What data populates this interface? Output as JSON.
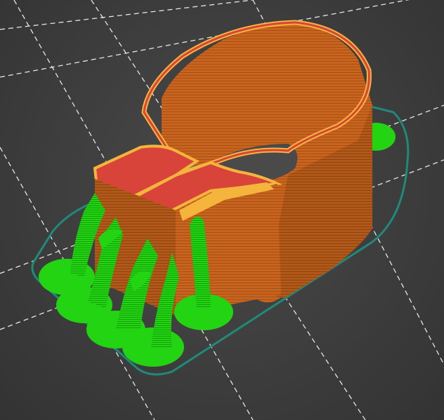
{
  "viewport": {
    "name": "gcode-preview",
    "background_color": "#3c3c3c",
    "bed_line_color": "#e6e6e6",
    "skirt_color": "#1f8a78",
    "wall_color": "#c8641e",
    "wall_dark_color": "#9c4a14",
    "perimeter_color": "#f5b53c",
    "top_infill_color": "#d8443a",
    "support_color": "#22d411",
    "support_dark_color": "#14a00a"
  }
}
